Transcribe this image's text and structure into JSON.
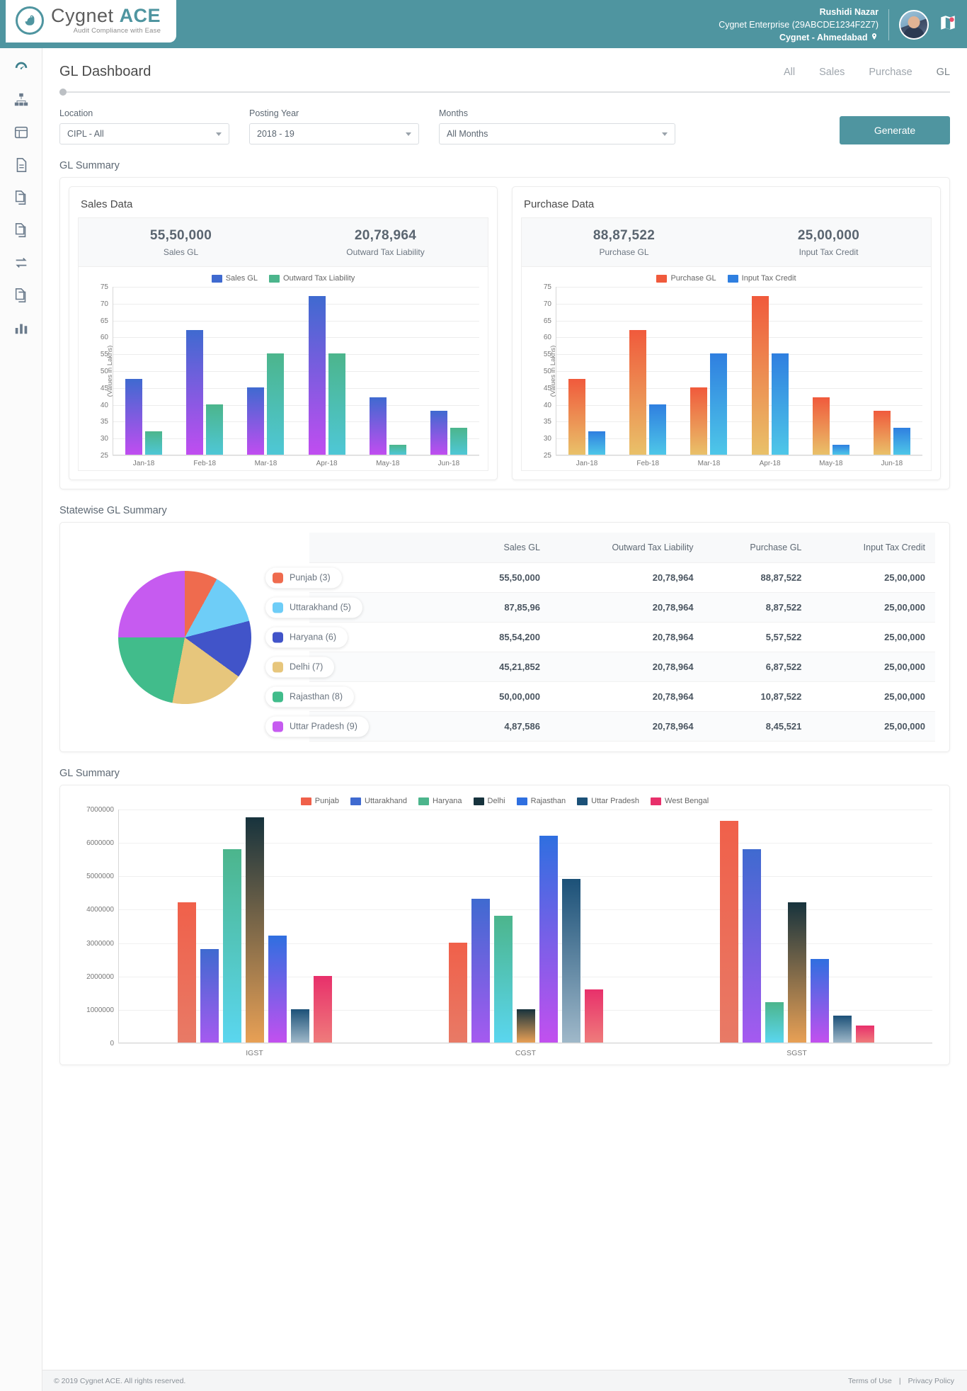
{
  "brand": {
    "name_light": "Cygnet ",
    "name_bold": "ACE",
    "tagline": "Audit  Compliance with Ease",
    "logo_icon": "swan-logo-icon",
    "accent": "#4f95a0"
  },
  "header": {
    "user_name": "Rushidi Nazar",
    "enterprise": "Cygnet Enterprise (29ABCDE1234F2Z7)",
    "location": "Cygnet - Ahmedabad",
    "location_pin": "☉",
    "map_icon": "map-icon"
  },
  "rail": {
    "items": [
      {
        "name": "dashboard",
        "icon": "speedometer-icon"
      },
      {
        "name": "organization",
        "icon": "sitemap-icon"
      },
      {
        "name": "ledger",
        "icon": "ledger-icon"
      },
      {
        "name": "documents",
        "icon": "document-icon"
      },
      {
        "name": "reports",
        "icon": "copy-document-icon"
      },
      {
        "name": "archive",
        "icon": "archive-icon"
      },
      {
        "name": "reconcile",
        "icon": "exchange-icon"
      },
      {
        "name": "files",
        "icon": "files-icon"
      },
      {
        "name": "analytics",
        "icon": "bar-chart-icon"
      }
    ]
  },
  "page": {
    "title": "GL Dashboard",
    "tabs": [
      {
        "label": "All",
        "active": false
      },
      {
        "label": "Sales",
        "active": false
      },
      {
        "label": "Purchase",
        "active": false
      },
      {
        "label": "GL",
        "active": true
      }
    ]
  },
  "filters": {
    "location": {
      "label": "Location",
      "value": "CIPL - All"
    },
    "posting_year": {
      "label": "Posting Year",
      "value": "2018 - 19"
    },
    "months": {
      "label": "Months",
      "value": "All Months"
    },
    "generate_label": "Generate"
  },
  "gl_summary": {
    "section_title": "GL Summary",
    "sales": {
      "card_title": "Sales Data",
      "kpis": [
        {
          "value": "55,50,000",
          "label": "Sales GL"
        },
        {
          "value": "20,78,964",
          "label": "Outward Tax Liability"
        }
      ]
    },
    "purchase": {
      "card_title": "Purchase Data",
      "kpis": [
        {
          "value": "88,87,522",
          "label": "Purchase GL"
        },
        {
          "value": "25,00,000",
          "label": "Input Tax Credit"
        }
      ]
    }
  },
  "statewise": {
    "section_title": "Statewise GL Summary",
    "columns": [
      "",
      "Sales GL",
      "Outward Tax Liability",
      "Purchase GL",
      "Input Tax Credit"
    ],
    "rows": [
      {
        "state": "Punjab (3)",
        "color": "#ef6b4e",
        "sales_gl": "55,50,000",
        "outward": "20,78,964",
        "purchase_gl": "88,87,522",
        "itc": "25,00,000"
      },
      {
        "state": "Uttarakhand (5)",
        "color": "#6ecdf7",
        "sales_gl": "87,85,96",
        "outward": "20,78,964",
        "purchase_gl": "8,87,522",
        "itc": "25,00,000"
      },
      {
        "state": "Haryana (6)",
        "color": "#4154c9",
        "sales_gl": "85,54,200",
        "outward": "20,78,964",
        "purchase_gl": "5,57,522",
        "itc": "25,00,000"
      },
      {
        "state": "Delhi (7)",
        "color": "#e7c67c",
        "sales_gl": "45,21,852",
        "outward": "20,78,964",
        "purchase_gl": "6,87,522",
        "itc": "25,00,000"
      },
      {
        "state": "Rajasthan (8)",
        "color": "#41bc8b",
        "sales_gl": "50,00,000",
        "outward": "20,78,964",
        "purchase_gl": "10,87,522",
        "itc": "25,00,000"
      },
      {
        "state": "Uttar Pradesh (9)",
        "color": "#c65bf0",
        "sales_gl": "4,87,586",
        "outward": "20,78,964",
        "purchase_gl": "8,45,521",
        "itc": "25,00,000"
      }
    ]
  },
  "bottom_section": {
    "section_title": "GL Summary"
  },
  "footer": {
    "copyright": "© 2019 Cygnet ACE. All rights reserved.",
    "terms": "Terms of Use",
    "divider": "|",
    "privacy": "Privacy Policy"
  },
  "chart_data": [
    {
      "type": "bar",
      "title": "Sales Data",
      "xlabel": "",
      "ylabel": "(Values in Lakhs)",
      "ylim": [
        25,
        75
      ],
      "yticks": [
        25,
        30,
        35,
        40,
        45,
        50,
        55,
        60,
        65,
        70,
        75
      ],
      "grid": true,
      "legend_position": "top",
      "categories": [
        "Jan-18",
        "Feb-18",
        "Mar-18",
        "Apr-18",
        "May-18",
        "Jun-18"
      ],
      "series": [
        {
          "name": "Sales GL",
          "color": "#3f6ad0",
          "color2": "#c04df0",
          "values": [
            47.5,
            62,
            45,
            72,
            42,
            38
          ]
        },
        {
          "name": "Outward Tax Liability",
          "color": "#4cb58c",
          "color2": "#4ec7d6",
          "values": [
            32,
            40,
            55,
            55,
            28,
            33
          ]
        }
      ]
    },
    {
      "type": "bar",
      "title": "Purchase Data",
      "xlabel": "",
      "ylabel": "(Values in Lakhs)",
      "ylim": [
        25,
        75
      ],
      "yticks": [
        25,
        30,
        35,
        40,
        45,
        50,
        55,
        60,
        65,
        70,
        75
      ],
      "grid": true,
      "legend_position": "top",
      "categories": [
        "Jan-18",
        "Feb-18",
        "Mar-18",
        "Apr-18",
        "May-18",
        "Jun-18"
      ],
      "series": [
        {
          "name": "Purchase GL",
          "color": "#f05a3c",
          "color2": "#e9c169",
          "values": [
            47.5,
            62,
            45,
            72,
            42,
            38
          ]
        },
        {
          "name": "Input Tax Credit",
          "color": "#2f7fe0",
          "color2": "#4ec7e8",
          "values": [
            32,
            40,
            55,
            55,
            28,
            33
          ]
        }
      ]
    },
    {
      "type": "pie",
      "title": "Statewise GL Summary",
      "labels": [
        "Punjab (3)",
        "Uttarakhand (5)",
        "Haryana (6)",
        "Delhi (7)",
        "Rajasthan (8)",
        "Uttar Pradesh (9)"
      ],
      "colors": [
        "#ef6b4e",
        "#6ecdf7",
        "#4154c9",
        "#e7c67c",
        "#41bc8b",
        "#c65bf0"
      ],
      "values": [
        8,
        13,
        14,
        18,
        22,
        25
      ]
    },
    {
      "type": "bar",
      "title": "GL Summary",
      "xlabel": "",
      "ylabel": "",
      "ylim": [
        0,
        7000000
      ],
      "yticks": [
        0,
        1000000,
        2000000,
        3000000,
        4000000,
        5000000,
        6000000,
        7000000
      ],
      "ytick_labels": [
        "0",
        "1000000",
        "2000000",
        "3000000",
        "4000000",
        "5000000",
        "6000000",
        "7000000"
      ],
      "grid": true,
      "legend_position": "top",
      "categories": [
        "IGST",
        "CGST",
        "SGST"
      ],
      "series": [
        {
          "name": "Punjab",
          "color": "#f0604a",
          "values": [
            4200000,
            3000000,
            6650000
          ]
        },
        {
          "name": "Uttarakhand",
          "color": "#3f6ad0",
          "values": [
            2800000,
            4300000,
            5800000
          ]
        },
        {
          "name": "Haryana",
          "color": "#4cb58c",
          "values": [
            5800000,
            3800000,
            1200000
          ]
        },
        {
          "name": "Delhi",
          "color": "#17333d",
          "values": [
            6750000,
            1000000,
            4200000
          ]
        },
        {
          "name": "Rajasthan",
          "color": "#2f6fe0",
          "values": [
            3200000,
            6200000,
            2500000
          ]
        },
        {
          "name": "Uttar Pradesh",
          "color": "#1c5178",
          "values": [
            1000000,
            4900000,
            800000
          ]
        },
        {
          "name": "West Bengal",
          "color": "#e8306b",
          "values": [
            2000000,
            1600000,
            500000
          ]
        }
      ]
    }
  ]
}
